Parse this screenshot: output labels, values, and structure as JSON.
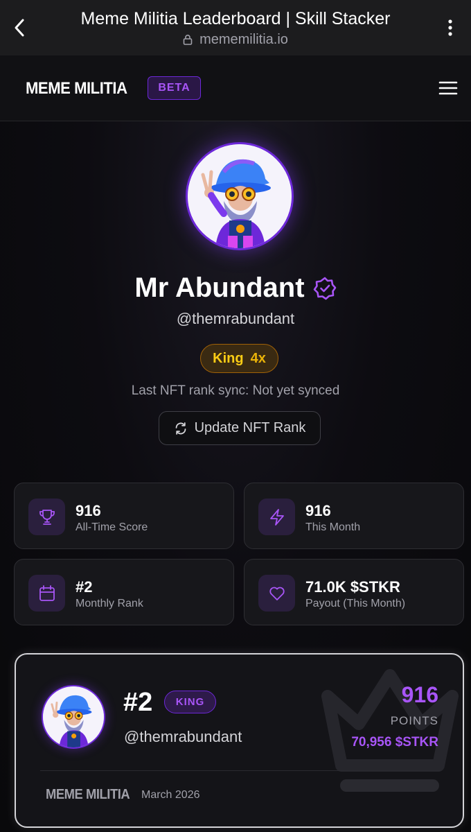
{
  "browser": {
    "title": "Meme Militia Leaderboard | Skill Stacker",
    "url": "mememilitia.io",
    "back_icon": "chevron-left-icon",
    "more_icon": "more-vertical-icon",
    "lock_icon": "lock-icon"
  },
  "header": {
    "brand": "MEME MILITIA",
    "badge": "BETA",
    "menu_icon": "hamburger-menu-icon"
  },
  "profile": {
    "name": "Mr Abundant",
    "verified_icon": "verified-badge-icon",
    "handle": "@themrabundant",
    "rank_tier": "King",
    "rank_multiplier": "4x",
    "sync_text": "Last NFT rank sync: Not yet synced",
    "update_button": "Update NFT Rank",
    "update_icon": "refresh-icon"
  },
  "stats": [
    {
      "icon": "trophy-icon",
      "value": "916",
      "label": "All-Time Score"
    },
    {
      "icon": "lightning-icon",
      "value": "916",
      "label": "This Month"
    },
    {
      "icon": "calendar-icon",
      "value": "#2",
      "label": "Monthly Rank"
    },
    {
      "icon": "heart-icon",
      "value": "71.0K $STKR",
      "label": "Payout (This Month)"
    }
  ],
  "leaderboard_card": {
    "rank": "#2",
    "tier": "KING",
    "handle": "@themrabundant",
    "points": "916",
    "points_label": "POINTS",
    "payout": "70,956 $STKR",
    "brand": "MEME MILITIA",
    "date": "March 2026",
    "crown_icon": "crown-icon"
  },
  "colors": {
    "accent": "#a855f7",
    "accent_dark": "#6d28d9",
    "gold": "#facc15",
    "background": "#09090b"
  }
}
